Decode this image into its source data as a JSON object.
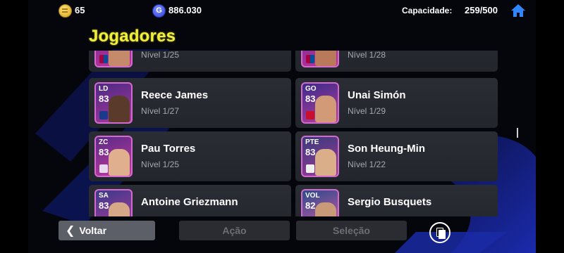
{
  "topbar": {
    "coins": "65",
    "gp_symbol": "G",
    "gp": "886.030",
    "capacity_label": "Capacidade:",
    "capacity_value": "259/500"
  },
  "title": "Jogadores",
  "players_partial_top": [
    {
      "level": "Nível 1/25"
    },
    {
      "level": "Nível 1/28"
    }
  ],
  "players": [
    {
      "position": "LD",
      "rating": "83",
      "name": "Reece James",
      "level": "Nível 1/27"
    },
    {
      "position": "GO",
      "rating": "83",
      "name": "Unai Simón",
      "level": "Nível 1/29"
    },
    {
      "position": "ZC",
      "rating": "83",
      "name": "Pau Torres",
      "level": "Nível 1/25"
    },
    {
      "position": "PTE",
      "rating": "83",
      "name": "Son Heung-Min",
      "level": "Nível 1/22"
    },
    {
      "position": "SA",
      "rating": "83",
      "name": "Antoine Griezmann",
      "level": ""
    },
    {
      "position": "VOL",
      "rating": "82",
      "name": "Sergio Busquets",
      "level": ""
    }
  ],
  "buttons": {
    "back": "Voltar",
    "action": "Ação",
    "selection": "Seleção"
  },
  "colors": {
    "title": "#f1ef3b",
    "accent_blue": "#1d2aa8",
    "card_bg": "#2b2d35"
  }
}
